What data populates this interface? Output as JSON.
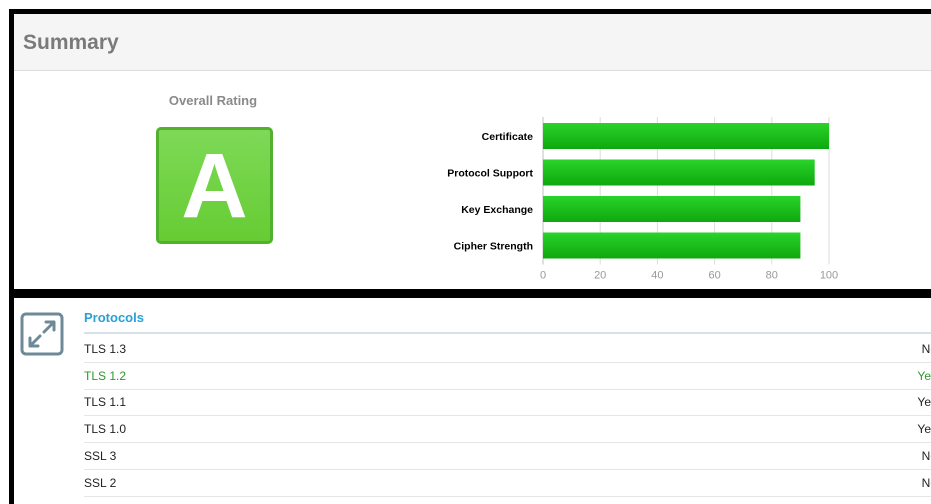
{
  "summary": {
    "title": "Summary",
    "overall_rating_label": "Overall Rating",
    "grade": "A",
    "grade_color": "#66cc33"
  },
  "chart_data": {
    "type": "bar",
    "orientation": "horizontal",
    "categories": [
      "Certificate",
      "Protocol Support",
      "Key Exchange",
      "Cipher Strength"
    ],
    "values": [
      100,
      95,
      90,
      90
    ],
    "xlim": [
      0,
      100
    ],
    "ticks": [
      "0",
      "20",
      "40",
      "60",
      "80",
      "100"
    ],
    "bar_color": "#1fbf1f",
    "grid": true
  },
  "protocols": {
    "title": "Protocols",
    "icon": "expand-arrows-icon",
    "rows": [
      {
        "name": "TLS 1.3",
        "value": "No",
        "status": "neutral"
      },
      {
        "name": "TLS 1.2",
        "value": "Yes",
        "status": "good"
      },
      {
        "name": "TLS 1.1",
        "value": "Yes",
        "status": "neutral"
      },
      {
        "name": "TLS 1.0",
        "value": "Yes",
        "status": "neutral"
      },
      {
        "name": "SSL 3",
        "value": "No",
        "status": "neutral"
      },
      {
        "name": "SSL 2",
        "value": "No",
        "status": "neutral"
      }
    ],
    "good_color": "#2a9a2a"
  }
}
